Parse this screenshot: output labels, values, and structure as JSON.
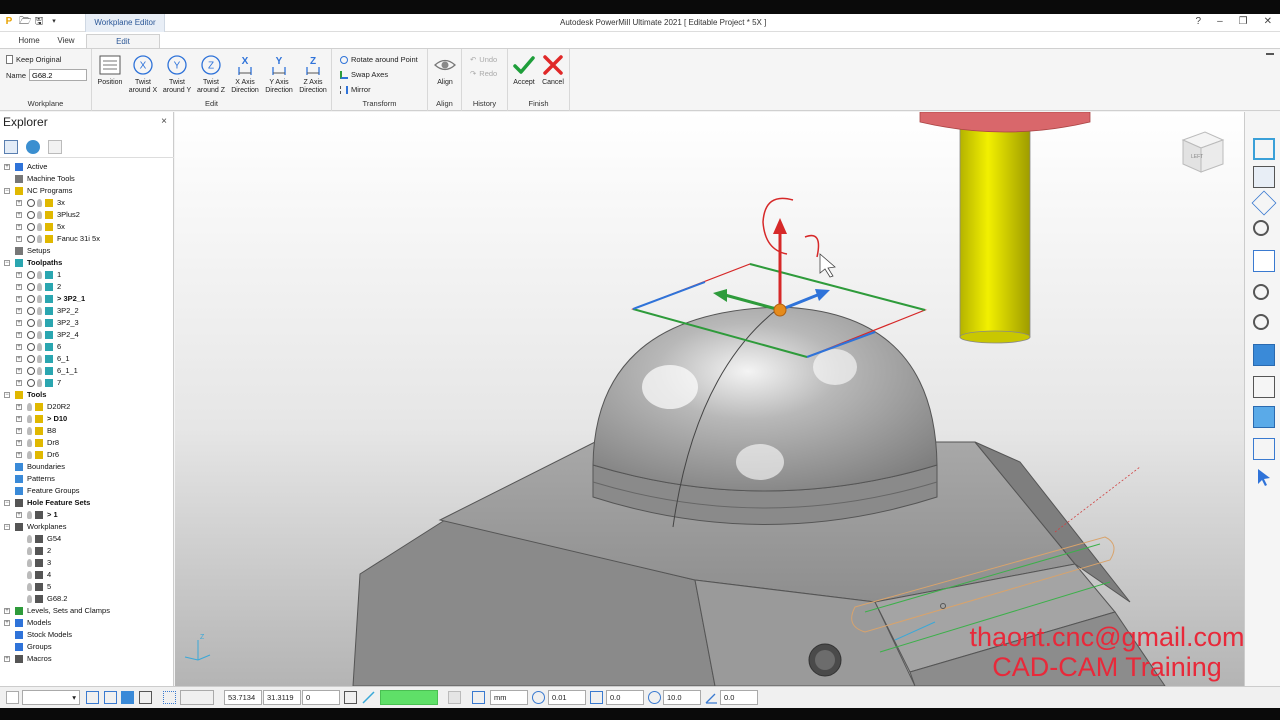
{
  "app": {
    "title": "Autodesk PowerMill Ultimate 2021   [ Editable Project * 5X ]",
    "context_tab": "Workplane Editor",
    "window_controls": [
      "?",
      "–",
      "❐",
      "✕"
    ]
  },
  "tabs": [
    {
      "label": "Home"
    },
    {
      "label": "View"
    },
    {
      "label": "Edit"
    }
  ],
  "ribbon": {
    "workplane": {
      "keep_original": "Keep Original",
      "name_label": "Name",
      "name_value": "G68.2",
      "group_label": "Workplane"
    },
    "edit": {
      "buttons": [
        {
          "label": "Position",
          "icon": "position-icon"
        },
        {
          "label": "Twist\naround X",
          "icon": "twist-x-icon",
          "letter": "X"
        },
        {
          "label": "Twist\naround Y",
          "icon": "twist-y-icon",
          "letter": "Y"
        },
        {
          "label": "Twist\naround Z",
          "icon": "twist-z-icon",
          "letter": "Z"
        },
        {
          "label": "X Axis\nDirection",
          "icon": "x-axis-direction-icon",
          "letter": "X"
        },
        {
          "label": "Y Axis\nDirection",
          "icon": "y-axis-direction-icon",
          "letter": "Y"
        },
        {
          "label": "Z Axis\nDirection",
          "icon": "z-axis-direction-icon",
          "letter": "Z"
        }
      ],
      "group_label": "Edit"
    },
    "transform": {
      "items": [
        "Rotate around Point",
        "Swap Axes",
        "Mirror"
      ],
      "group_label": "Transform"
    },
    "align": {
      "button": "Align",
      "group_label": "Align"
    },
    "history": {
      "undo": "Undo",
      "redo": "Redo",
      "group_label": "History"
    },
    "finish": {
      "accept": "Accept",
      "cancel": "Cancel",
      "group_label": "Finish"
    }
  },
  "explorer": {
    "title": "Explorer",
    "close": "×",
    "tree": [
      {
        "label": "Active",
        "level": 0,
        "expander": "+",
        "icon": "active-icon",
        "bold": false
      },
      {
        "label": "Machine Tools",
        "level": 0,
        "expander": "",
        "icon": "machine-tool-icon",
        "bold": false
      },
      {
        "label": "NC Programs",
        "level": 0,
        "expander": "−",
        "icon": "nc-program-icon",
        "bold": false
      },
      {
        "label": "3x",
        "level": 1,
        "expander": "+",
        "icon": "nc-program-icon",
        "bold": false
      },
      {
        "label": "3Plus2",
        "level": 1,
        "expander": "+",
        "icon": "nc-program-icon",
        "bold": false
      },
      {
        "label": "5x",
        "level": 1,
        "expander": "+",
        "icon": "nc-program-icon",
        "bold": false
      },
      {
        "label": "Fanuc 31i 5x",
        "level": 1,
        "expander": "+",
        "icon": "nc-program-icon",
        "bold": false
      },
      {
        "label": "Setups",
        "level": 0,
        "expander": "",
        "icon": "setup-icon",
        "bold": false
      },
      {
        "label": "Toolpaths",
        "level": 0,
        "expander": "−",
        "icon": "toolpath-icon",
        "bold": true
      },
      {
        "label": "1",
        "level": 1,
        "expander": "+",
        "icon": "toolpath-icon",
        "bold": false
      },
      {
        "label": "2",
        "level": 1,
        "expander": "+",
        "icon": "toolpath-icon",
        "bold": false
      },
      {
        "label": "> 3P2_1",
        "level": 1,
        "expander": "+",
        "icon": "toolpath-icon",
        "bold": true
      },
      {
        "label": "3P2_2",
        "level": 1,
        "expander": "+",
        "icon": "toolpath-icon",
        "bold": false
      },
      {
        "label": "3P2_3",
        "level": 1,
        "expander": "+",
        "icon": "toolpath-icon",
        "bold": false
      },
      {
        "label": "3P2_4",
        "level": 1,
        "expander": "+",
        "icon": "toolpath-icon",
        "bold": false
      },
      {
        "label": "6",
        "level": 1,
        "expander": "+",
        "icon": "toolpath-icon",
        "bold": false
      },
      {
        "label": "6_1",
        "level": 1,
        "expander": "+",
        "icon": "toolpath-icon",
        "bold": false
      },
      {
        "label": "6_1_1",
        "level": 1,
        "expander": "+",
        "icon": "toolpath-icon",
        "bold": false
      },
      {
        "label": "7",
        "level": 1,
        "expander": "+",
        "icon": "toolpath-icon",
        "bold": false
      },
      {
        "label": "Tools",
        "level": 0,
        "expander": "−",
        "icon": "tool-icon",
        "bold": true
      },
      {
        "label": "D20R2",
        "level": 1,
        "expander": "+",
        "icon": "tool-icon",
        "bold": false
      },
      {
        "label": "> D10",
        "level": 1,
        "expander": "+",
        "icon": "tool-icon",
        "bold": true
      },
      {
        "label": "B8",
        "level": 1,
        "expander": "+",
        "icon": "tool-icon",
        "bold": false
      },
      {
        "label": "Dr8",
        "level": 1,
        "expander": "+",
        "icon": "tool-icon",
        "bold": false
      },
      {
        "label": "Dr6",
        "level": 1,
        "expander": "+",
        "icon": "tool-icon",
        "bold": false
      },
      {
        "label": "Boundaries",
        "level": 0,
        "expander": "",
        "icon": "boundary-icon",
        "bold": false
      },
      {
        "label": "Patterns",
        "level": 0,
        "expander": "",
        "icon": "pattern-icon",
        "bold": false
      },
      {
        "label": "Feature Groups",
        "level": 0,
        "expander": "",
        "icon": "feature-group-icon",
        "bold": false
      },
      {
        "label": "Hole Feature Sets",
        "level": 0,
        "expander": "−",
        "icon": "hole-feature-icon",
        "bold": true
      },
      {
        "label": "> 1",
        "level": 1,
        "expander": "+",
        "icon": "hole-feature-icon",
        "bold": true
      },
      {
        "label": "Workplanes",
        "level": 0,
        "expander": "−",
        "icon": "workplane-icon",
        "bold": false
      },
      {
        "label": "G54",
        "level": 1,
        "expander": "",
        "icon": "workplane-icon",
        "bold": false
      },
      {
        "label": "2",
        "level": 1,
        "expander": "",
        "icon": "workplane-icon",
        "bold": false
      },
      {
        "label": "3",
        "level": 1,
        "expander": "",
        "icon": "workplane-icon",
        "bold": false
      },
      {
        "label": "4",
        "level": 1,
        "expander": "",
        "icon": "workplane-icon",
        "bold": false
      },
      {
        "label": "5",
        "level": 1,
        "expander": "",
        "icon": "workplane-icon",
        "bold": false
      },
      {
        "label": "G68.2",
        "level": 1,
        "expander": "",
        "icon": "workplane-icon",
        "bold": false
      },
      {
        "label": "Levels, Sets and Clamps",
        "level": 0,
        "expander": "+",
        "icon": "level-icon",
        "bold": false
      },
      {
        "label": "Models",
        "level": 0,
        "expander": "+",
        "icon": "model-icon",
        "bold": false
      },
      {
        "label": "Stock Models",
        "level": 0,
        "expander": "",
        "icon": "stock-model-icon",
        "bold": false
      },
      {
        "label": "Groups",
        "level": 0,
        "expander": "",
        "icon": "group-icon",
        "bold": false
      },
      {
        "label": "Macros",
        "level": 0,
        "expander": "+",
        "icon": "macro-icon",
        "bold": false
      }
    ]
  },
  "viewport": {
    "viewcube_label": "LEFT",
    "triad_label": "Z",
    "colors": {
      "x_axis": "#2f73d9",
      "y_axis": "#2e9b3b",
      "z_axis": "#d62828",
      "tool_shank": "#e4e200",
      "holder": "#d9676b"
    }
  },
  "watermark": {
    "email": "thaont.cnc@gmail.com",
    "text": "CAD-CAM Training",
    "color": "#e8293a"
  },
  "statusbar": {
    "coord_x": "53.7134",
    "coord_y": "31.3119",
    "coord_z": "0",
    "units": "mm",
    "tolerance": "0.01",
    "thickness": "0.0",
    "diameter": "10.0",
    "angle": "0.0"
  }
}
